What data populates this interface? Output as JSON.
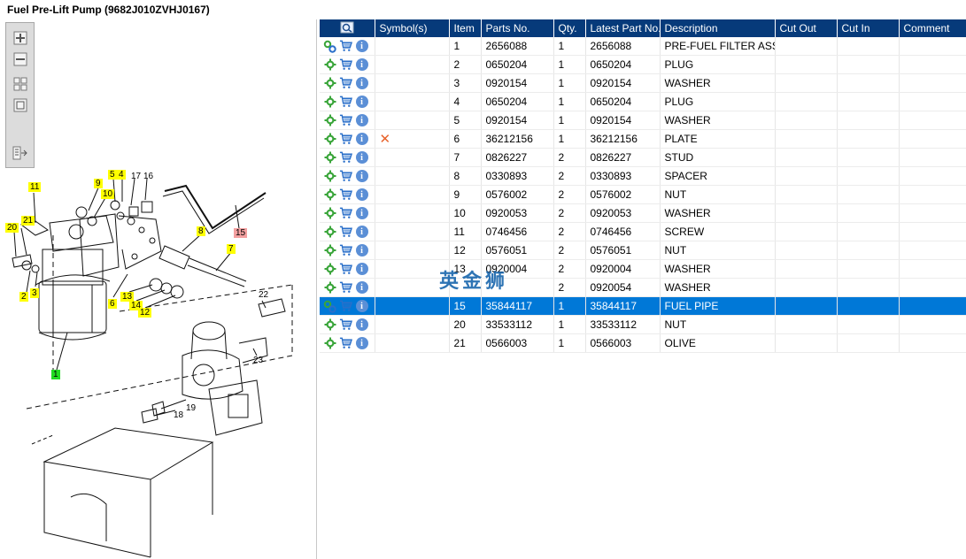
{
  "title": "Fuel Pre-Lift Pump (9682J010ZVHJ0167)",
  "toolbar": {
    "buttons": [
      "zoom-in",
      "zoom-out",
      "fit-all",
      "fit-page",
      "export"
    ]
  },
  "diagram": {
    "callouts": [
      "11",
      "9",
      "10",
      "5",
      "4",
      "17",
      "16",
      "20",
      "21",
      "8",
      "15",
      "7",
      "2",
      "3",
      "6",
      "13",
      "14",
      "12",
      "22",
      "1",
      "23",
      "18",
      "19"
    ],
    "highlight_color_default": "#ffff00",
    "highlight_color_selected": "#f4a0a0",
    "highlight_color_main": "#22dd22"
  },
  "table": {
    "headers": [
      "",
      "Symbol(s)",
      "Item",
      "Parts No.",
      "Qty.",
      "Latest Part No.",
      "Description",
      "Cut Out",
      "Cut In",
      "Comment"
    ],
    "rows": [
      {
        "symbol": "",
        "item": "1",
        "part": "2656088",
        "qty": "1",
        "latest": "2656088",
        "desc": "PRE-FUEL FILTER ASSY",
        "cut_out": "",
        "cut_in": "",
        "comment": "",
        "icon": "gears"
      },
      {
        "symbol": "",
        "item": "2",
        "part": "0650204",
        "qty": "1",
        "latest": "0650204",
        "desc": "PLUG",
        "cut_out": "",
        "cut_in": "",
        "comment": "",
        "icon": "gear"
      },
      {
        "symbol": "",
        "item": "3",
        "part": "0920154",
        "qty": "1",
        "latest": "0920154",
        "desc": "WASHER",
        "cut_out": "",
        "cut_in": "",
        "comment": "",
        "icon": "gear"
      },
      {
        "symbol": "",
        "item": "4",
        "part": "0650204",
        "qty": "1",
        "latest": "0650204",
        "desc": "PLUG",
        "cut_out": "",
        "cut_in": "",
        "comment": "",
        "icon": "gear"
      },
      {
        "symbol": "",
        "item": "5",
        "part": "0920154",
        "qty": "1",
        "latest": "0920154",
        "desc": "WASHER",
        "cut_out": "",
        "cut_in": "",
        "comment": "",
        "icon": "gear"
      },
      {
        "symbol": "x",
        "item": "6",
        "part": "36212156",
        "qty": "1",
        "latest": "36212156",
        "desc": "PLATE",
        "cut_out": "",
        "cut_in": "",
        "comment": "",
        "icon": "gear"
      },
      {
        "symbol": "",
        "item": "7",
        "part": "0826227",
        "qty": "2",
        "latest": "0826227",
        "desc": "STUD",
        "cut_out": "",
        "cut_in": "",
        "comment": "",
        "icon": "gear"
      },
      {
        "symbol": "",
        "item": "8",
        "part": "0330893",
        "qty": "2",
        "latest": "0330893",
        "desc": "SPACER",
        "cut_out": "",
        "cut_in": "",
        "comment": "",
        "icon": "gear"
      },
      {
        "symbol": "",
        "item": "9",
        "part": "0576002",
        "qty": "2",
        "latest": "0576002",
        "desc": "NUT",
        "cut_out": "",
        "cut_in": "",
        "comment": "",
        "icon": "gear"
      },
      {
        "symbol": "",
        "item": "10",
        "part": "0920053",
        "qty": "2",
        "latest": "0920053",
        "desc": "WASHER",
        "cut_out": "",
        "cut_in": "",
        "comment": "",
        "icon": "gear"
      },
      {
        "symbol": "",
        "item": "11",
        "part": "0746456",
        "qty": "2",
        "latest": "0746456",
        "desc": "SCREW",
        "cut_out": "",
        "cut_in": "",
        "comment": "",
        "icon": "gear"
      },
      {
        "symbol": "",
        "item": "12",
        "part": "0576051",
        "qty": "2",
        "latest": "0576051",
        "desc": "NUT",
        "cut_out": "",
        "cut_in": "",
        "comment": "",
        "icon": "gear"
      },
      {
        "symbol": "",
        "item": "13",
        "part": "0920004",
        "qty": "2",
        "latest": "0920004",
        "desc": "WASHER",
        "cut_out": "",
        "cut_in": "",
        "comment": "",
        "icon": "gear"
      },
      {
        "symbol": "",
        "item": "",
        "part": "",
        "qty": "2",
        "latest": "0920054",
        "desc": "WASHER",
        "cut_out": "",
        "cut_in": "",
        "comment": "",
        "icon": "gear"
      },
      {
        "symbol": "",
        "item": "15",
        "part": "35844117",
        "qty": "1",
        "latest": "35844117",
        "desc": "FUEL PIPE",
        "cut_out": "",
        "cut_in": "",
        "comment": "",
        "icon": "gears",
        "selected": true
      },
      {
        "symbol": "",
        "item": "20",
        "part": "33533112",
        "qty": "1",
        "latest": "33533112",
        "desc": "NUT",
        "cut_out": "",
        "cut_in": "",
        "comment": "",
        "icon": "gear"
      },
      {
        "symbol": "",
        "item": "21",
        "part": "0566003",
        "qty": "1",
        "latest": "0566003",
        "desc": "OLIVE",
        "cut_out": "",
        "cut_in": "",
        "comment": "",
        "icon": "gear"
      }
    ]
  },
  "watermark": "英金狮",
  "colors": {
    "header_bg": "#063a7a",
    "selected_bg": "#0078d7",
    "gear_green": "#3aa53a",
    "cart_blue": "#2a6fc9",
    "x_orange": "#e8622a"
  }
}
